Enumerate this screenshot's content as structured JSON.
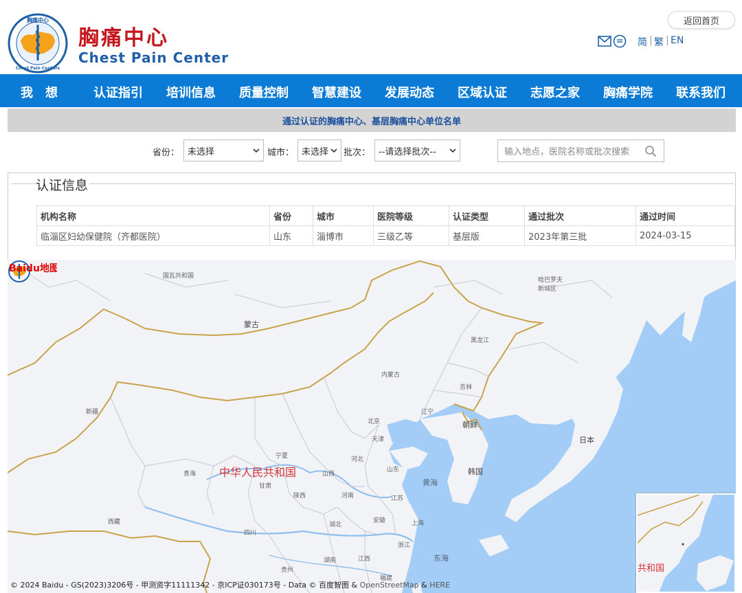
{
  "brand": {
    "name_cn": "胸痛中心",
    "name_en": "Chest Pain Center",
    "logo_text_top": "胸痛中心",
    "logo_text_bottom": "Chest Pain Centers"
  },
  "header": {
    "home_button": "返回首页",
    "languages": [
      "简",
      "繁",
      "EN"
    ]
  },
  "nav": {
    "items": [
      "我　想",
      "认证指引",
      "培训信息",
      "质量控制",
      "智慧建设",
      "发展动态",
      "区域认证",
      "志愿之家",
      "胸痛学院",
      "联系我们"
    ]
  },
  "banner": {
    "text": "通过认证的胸痛中心、基层胸痛中心单位名单"
  },
  "filters": {
    "province_label": "省份：",
    "province_value": "未选择",
    "city_label": "城市：",
    "city_value": "未选择",
    "batch_label": "批次：",
    "batch_value": "--请选择批次--",
    "search_placeholder": "输入地点，医院名称或批次搜索"
  },
  "info": {
    "legend": "认证信息",
    "columns": [
      "机构名称",
      "省份",
      "城市",
      "医院等级",
      "认证类型",
      "通过批次",
      "通过时间"
    ],
    "rows": [
      [
        "临淄区妇幼保健院（齐都医院）",
        "山东",
        "淄博市",
        "三级乙等",
        "基层版",
        "2023年第三批",
        "2024-03-15"
      ]
    ]
  },
  "map": {
    "labels": {
      "mongolia_region": "国瓦共和国",
      "mongolia": "蒙古",
      "harbin": "哈巴罗夫\n新城区",
      "heilongjiang": "黑龙江",
      "neimenggu": "内蒙古",
      "jilin": "吉林",
      "xinjiang": "新疆",
      "liaoning": "辽宁",
      "beijing": "北京",
      "tianjin": "天津",
      "hebei": "河北",
      "north_korea": "朝鲜",
      "japan": "日本",
      "china": "中华人民共和国",
      "qinghai": "青海",
      "ningxia": "宁夏",
      "shanxi": "山西",
      "shandong": "山东",
      "south_korea": "韩国",
      "gansu": "甘肃",
      "shaanxi": "陕西",
      "henan": "河南",
      "jiangsu": "江苏",
      "yellow_sea": "黄海",
      "tibet": "西藏",
      "sichuan": "四川",
      "hubei": "湖北",
      "anhui": "安徽",
      "shanghai": "上海",
      "zhejiang": "浙江",
      "east_sea": "东海",
      "hunan": "湖南",
      "jiangxi": "江西",
      "guizhou": "贵州",
      "fujian": "福建",
      "overview_china": "共和国"
    },
    "baidu_logo": "Baidu地图",
    "copyright": "© 2024 Baidu - GS(2023)3206号 - 甲测资字11111342 - 京ICP证030173号 - Data © 百度智图 &",
    "copyright_osm": "OpenStreetMap",
    "copyright_amp": "&",
    "copyright_here": "HERE"
  }
}
